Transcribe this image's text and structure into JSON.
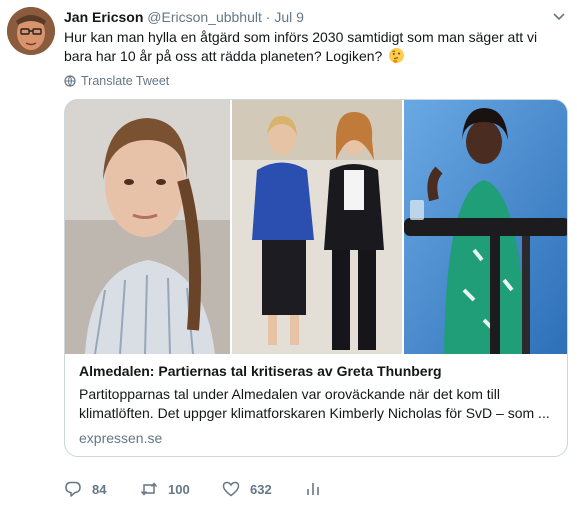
{
  "tweet": {
    "author_name": "Jan Ericson",
    "author_handle": "@Ericson_ubbhult",
    "separator": "·",
    "date": "Jul 9",
    "text": "Hur kan man hylla en åtgärd som införs 2030 samtidigt som man säger att vi bara har 10 år på oss att rädda planeten? Logiken?",
    "emoji": "thinking-face-emoji",
    "translate_label": "Translate Tweet"
  },
  "card": {
    "title": "Almedalen: Partiernas tal kritiseras av Greta Thunberg",
    "description": "Partitopparnas tal under Almedalen var oroväckande när det kom till klimatlöften. Det uppger klimatforskaren Kimberly Nicholas för SvD – som ...",
    "domain": "expressen.se"
  },
  "actions": {
    "replies": "84",
    "retweets": "100",
    "likes": "632"
  },
  "colors": {
    "text": "#14171a",
    "secondary": "#657786",
    "border": "#ccd6dd"
  },
  "icons": [
    "caret-down-icon",
    "globe-icon",
    "reply-icon",
    "retweet-icon",
    "heart-icon",
    "analytics-icon"
  ]
}
